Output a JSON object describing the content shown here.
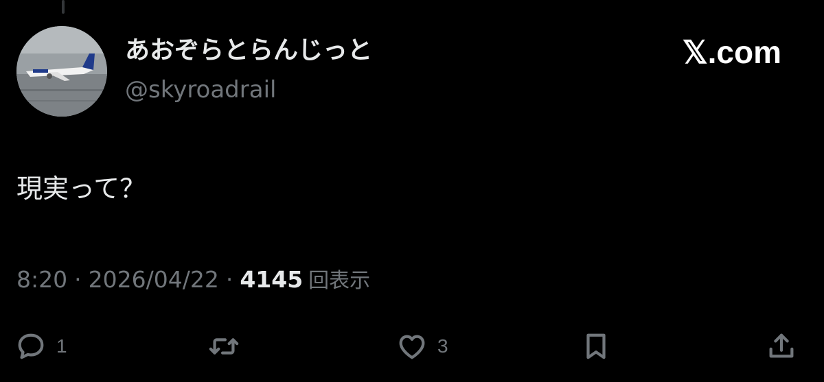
{
  "author": {
    "display_name": "あおぞらとらんじっと",
    "handle": "@skyroadrail"
  },
  "brand": {
    "text": "𝕏.com"
  },
  "post": {
    "text": "現実って？"
  },
  "meta": {
    "time": "8:20",
    "separator": "·",
    "date": "2026/04/22",
    "views_count": "4145",
    "views_label": "回表示"
  },
  "actions": {
    "reply_count": "1",
    "like_count": "3"
  },
  "colors": {
    "background": "#000000",
    "primary_text": "#e7e9ea",
    "secondary_text": "#71767b"
  },
  "icons": [
    "reply-icon",
    "repost-icon",
    "like-icon",
    "bookmark-icon",
    "share-icon"
  ]
}
